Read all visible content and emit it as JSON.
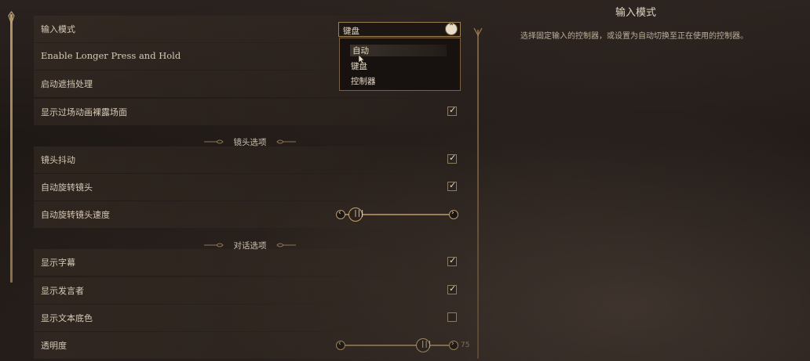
{
  "settings": {
    "input_mode": {
      "label": "输入模式",
      "selected": "键盘"
    },
    "longer_press": {
      "label": "Enable Longer Press and Hold"
    },
    "occlusion": {
      "label": "启动遮挡处理"
    },
    "nudity": {
      "label": "显示过场动画裸露场面",
      "checked": true
    },
    "camera_section": {
      "label": "镜头选项"
    },
    "camera_shake": {
      "label": "镜头抖动",
      "checked": true
    },
    "auto_rotate": {
      "label": "自动旋转镜头",
      "checked": true
    },
    "rotate_speed": {
      "label": "自动旋转镜头速度",
      "value": 0.1
    },
    "dialog_section": {
      "label": "对话选项"
    },
    "subtitles": {
      "label": "显示字幕",
      "checked": true
    },
    "speaker": {
      "label": "显示发言者",
      "checked": true
    },
    "text_bg": {
      "label": "显示文本底色",
      "checked": false
    },
    "opacity": {
      "label": "透明度",
      "value": 75,
      "value_text": "75"
    }
  },
  "dropdown": {
    "options": [
      "自动",
      "键盘",
      "控制器"
    ],
    "hovered": "自动"
  },
  "panel": {
    "title": "输入模式",
    "description": "选择固定输入的控制器，或设置为自动切换至正在使用的控制器。"
  },
  "glyphs": {
    "check": "✓",
    "caret_up": "⌃",
    "left": "‹",
    "right": "›",
    "grip": "|||"
  },
  "colors": {
    "accent": "#b39464",
    "text": "#d6cab6",
    "panel_bg": "#1e1815"
  }
}
